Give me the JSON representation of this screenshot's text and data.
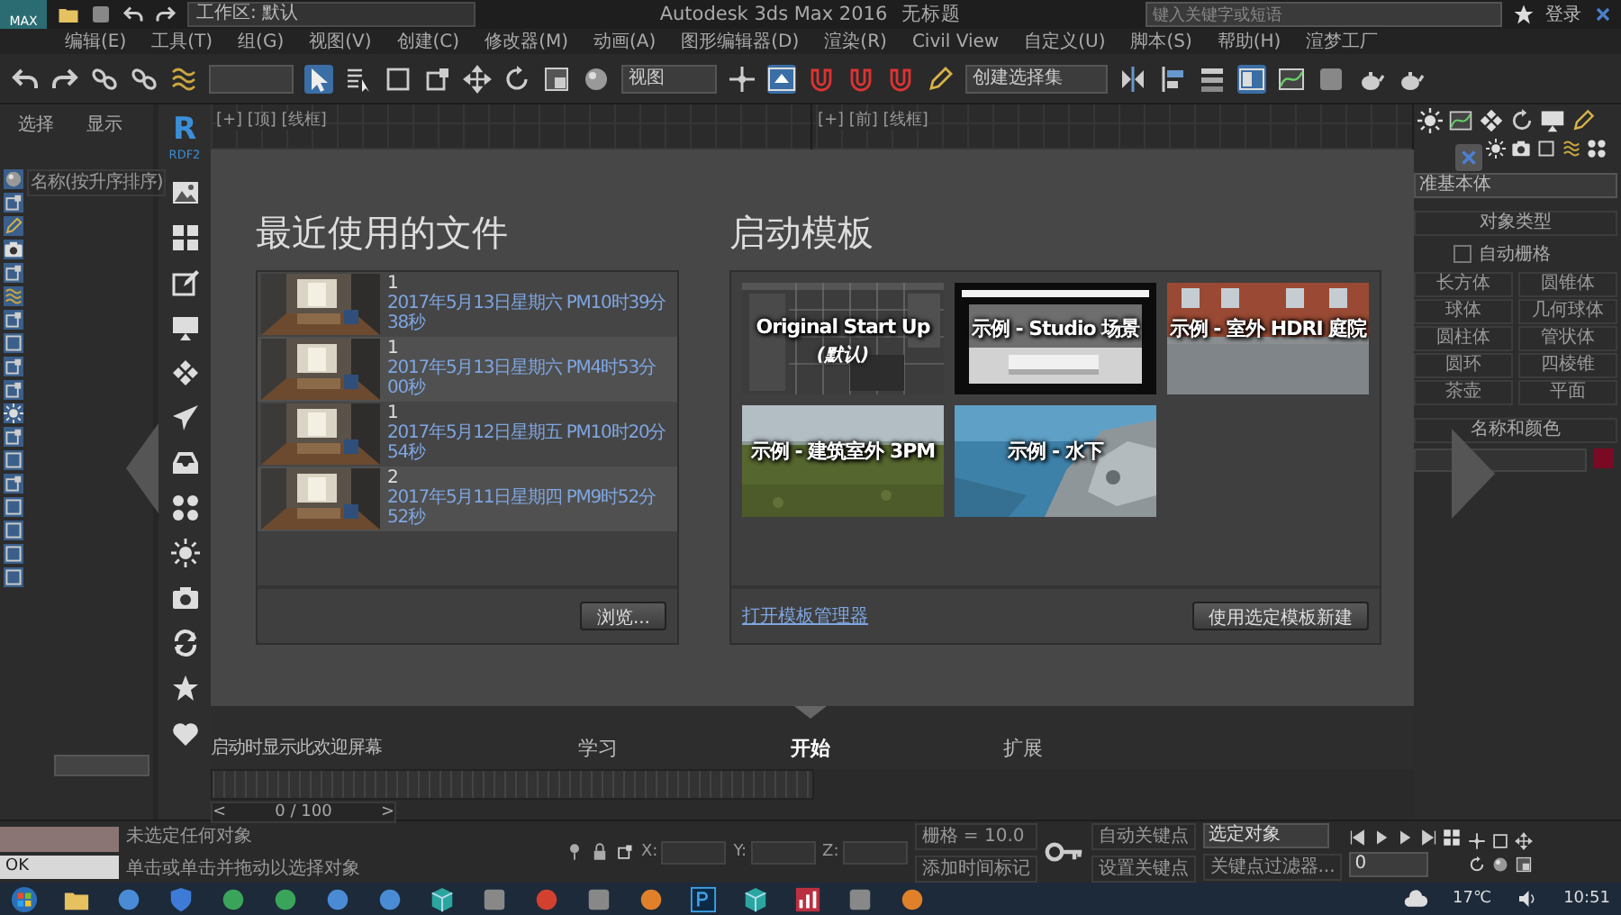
{
  "title_bar": {
    "app_badge": "MAX",
    "workspace": "工作区: 默认",
    "title": "Autodesk 3ds Max 2016",
    "document": "无标题",
    "search": {
      "placeholder": "键入关键字或短语"
    },
    "sign_in": "登录"
  },
  "menu_bar": [
    "编辑(E)",
    "工具(T)",
    "组(G)",
    "视图(V)",
    "创建(C)",
    "修改器(M)",
    "动画(A)",
    "图形编辑器(D)",
    "渲染(R)",
    "Civil View",
    "自定义(U)",
    "脚本(S)",
    "帮助(H)",
    "渲梦工厂"
  ],
  "toolbar": {
    "view_dropdown": "视图",
    "selection_set": "创建选择集"
  },
  "scene_explorer": {
    "tabs": [
      "选择",
      "显示"
    ],
    "column": "名称(按升序排序)"
  },
  "rdf_bar": {
    "logo": "R",
    "label": "RDF2"
  },
  "viewports": [
    {
      "label": "[+] [顶] [线框]"
    },
    {
      "label": "[+] [前] [线框]"
    }
  ],
  "welcome": {
    "recent": {
      "title": "最近使用的文件",
      "files": [
        {
          "name": "1",
          "date": "2017年5月13日星期六 PM10时39分38秒"
        },
        {
          "name": "1",
          "date": "2017年5月13日星期六 PM4时53分00秒"
        },
        {
          "name": "1",
          "date": "2017年5月12日星期五 PM10时20分54秒"
        },
        {
          "name": "2",
          "date": "2017年5月11日星期四 PM9时52分52秒"
        }
      ],
      "browse": "浏览..."
    },
    "templates": {
      "title": "启动模板",
      "items": [
        {
          "kind": "grid",
          "label": "Original Start Up",
          "note": "(默认)"
        },
        {
          "kind": "studio",
          "label": "示例 - Studio 场景"
        },
        {
          "kind": "courtyard",
          "label": "示例 - 室外 HDRI 庭院"
        },
        {
          "kind": "field",
          "label": "示例 - 建筑室外 3PM"
        },
        {
          "kind": "underwater",
          "label": "示例 - 水下"
        }
      ],
      "manager_link": "打开模板管理器",
      "create_button": "使用选定模板新建"
    },
    "startup_option": "启动时显示此欢迎屏幕",
    "tabs": [
      {
        "label": "学习",
        "selected": false
      },
      {
        "label": "开始",
        "selected": true
      },
      {
        "label": "扩展",
        "selected": false
      }
    ]
  },
  "command_panel": {
    "category": "准基本体",
    "object_type": "对象类型",
    "autogrid": {
      "label": "自动栅格",
      "checked": false
    },
    "buttons": [
      "长方体",
      "圆锥体",
      "球体",
      "几何球体",
      "圆柱体",
      "管状体",
      "圆环",
      "四棱锥",
      "茶壶",
      "平面"
    ],
    "name_color": "名称和颜色"
  },
  "time_slider": {
    "prev": "<",
    "position": "0 / 100",
    "next": ">"
  },
  "status_bar": {
    "prompt": "OK",
    "selection": "未选定任何对象",
    "hint": "单击或单击并拖动以选择对象",
    "axes": [
      "X:",
      "Y:",
      "Z:"
    ],
    "grid": "栅格 = 10.0",
    "add_time_tag": "添加时间标记",
    "auto_key": "自动关键点",
    "set_key": "设置关键点",
    "key_mode": "选定对象",
    "key_filters": "关键点过滤器...",
    "frame": "0"
  },
  "taskbar": {
    "temperature": "17℃",
    "time": "10:51"
  }
}
